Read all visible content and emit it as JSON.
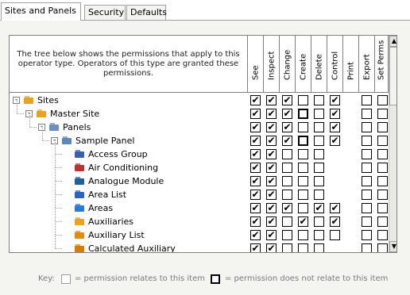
{
  "tabs": [
    {
      "label": "Sites and Panels",
      "active": true
    },
    {
      "label": "Security",
      "active": false
    },
    {
      "label": "Defaults",
      "active": false
    }
  ],
  "description": "The tree below shows the permissions that apply to this operator type. Operators of this type are granted these permissions.",
  "columns": [
    "See",
    "Inspect",
    "Change",
    "Create",
    "Delete",
    "Control",
    "Print",
    "Export",
    "Set Perms"
  ],
  "rows": [
    {
      "label": "Sites",
      "level": 0,
      "expander": "-",
      "icon": "folder-icon",
      "cells": [
        "check",
        "check",
        "check",
        "empty",
        "empty",
        "check",
        "none",
        "empty",
        "empty"
      ]
    },
    {
      "label": "Master Site",
      "level": 1,
      "expander": "-",
      "icon": "folder-icon",
      "cells": [
        "check",
        "check",
        "check",
        "na",
        "empty",
        "check",
        "none",
        "empty",
        "empty"
      ]
    },
    {
      "label": "Panels",
      "level": 2,
      "expander": "-",
      "icon": "panels-icon",
      "cells": [
        "check",
        "check",
        "check",
        "empty",
        "empty",
        "check",
        "none",
        "empty",
        "empty"
      ]
    },
    {
      "label": "Sample Panel",
      "level": 3,
      "expander": "-",
      "icon": "panel-icon",
      "cells": [
        "check",
        "check",
        "check",
        "na",
        "empty",
        "check",
        "none",
        "empty",
        "empty"
      ]
    },
    {
      "label": "Access Group",
      "level": 4,
      "icon": "access-group-icon",
      "cells": [
        "check",
        "check",
        "empty",
        "empty",
        "empty",
        "none",
        "none",
        "empty",
        "empty"
      ]
    },
    {
      "label": "Air Conditioning",
      "level": 4,
      "icon": "thermometer-icon",
      "cells": [
        "check",
        "check",
        "empty",
        "empty",
        "empty",
        "none",
        "none",
        "empty",
        "empty"
      ]
    },
    {
      "label": "Analogue Module",
      "level": 4,
      "icon": "module-icon",
      "cells": [
        "check",
        "check",
        "empty",
        "empty",
        "empty",
        "none",
        "none",
        "empty",
        "empty"
      ]
    },
    {
      "label": "Area List",
      "level": 4,
      "icon": "area-list-icon",
      "cells": [
        "check",
        "check",
        "empty",
        "empty",
        "empty",
        "none",
        "none",
        "empty",
        "empty"
      ]
    },
    {
      "label": "Areas",
      "level": 4,
      "icon": "area-icon",
      "cells": [
        "check",
        "check",
        "check",
        "empty",
        "check",
        "check",
        "none",
        "empty",
        "empty"
      ]
    },
    {
      "label": "Auxiliaries",
      "level": 4,
      "icon": "auxiliary-icon",
      "cells": [
        "check",
        "check",
        "empty",
        "check",
        "empty",
        "check",
        "none",
        "empty",
        "empty"
      ]
    },
    {
      "label": "Auxiliary List",
      "level": 4,
      "icon": "auxiliary-list-icon",
      "cells": [
        "check",
        "check",
        "empty",
        "empty",
        "empty",
        "empty",
        "none",
        "empty",
        "empty"
      ]
    },
    {
      "label": "Calculated Auxiliary",
      "level": 4,
      "icon": "calculated-icon",
      "cells": [
        "check",
        "check",
        "empty",
        "empty",
        "empty",
        "none",
        "none",
        "empty",
        "empty"
      ]
    }
  ],
  "key": {
    "prefix": "Key:",
    "relates": "= permission relates to this item",
    "not_relates": "= permission does not relate to this item"
  },
  "scrollbar": {
    "up": "▲",
    "down": "▼"
  }
}
